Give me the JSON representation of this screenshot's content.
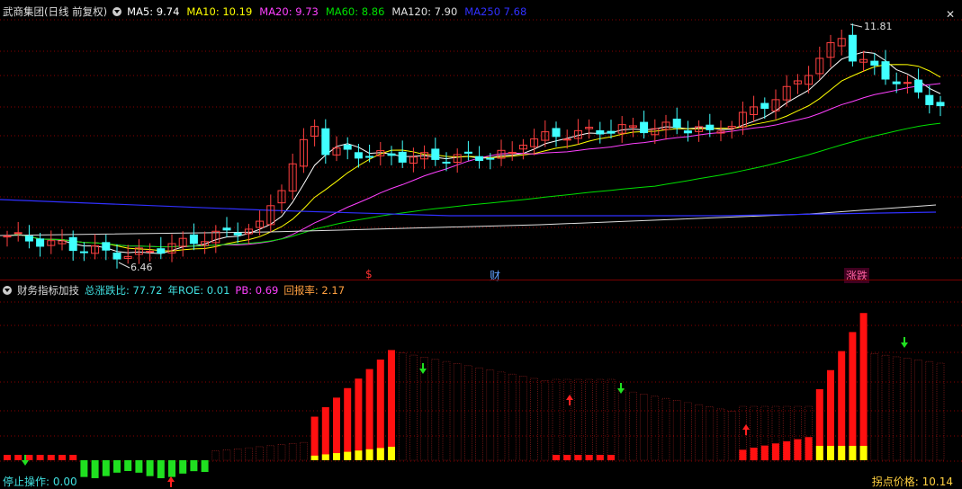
{
  "main_header": {
    "title": "武商集团(日线 前复权)",
    "indicators": [
      {
        "label": "MA5:",
        "value": "9.74",
        "color": "#ffffff"
      },
      {
        "label": "MA10:",
        "value": "10.19",
        "color": "#ffff00"
      },
      {
        "label": "MA20:",
        "value": "9.73",
        "color": "#ff40ff"
      },
      {
        "label": "MA60:",
        "value": "8.86",
        "color": "#00e000"
      },
      {
        "label": "MA120:",
        "value": "7.90",
        "color": "#e0e0e0"
      },
      {
        "label": "MA250",
        "value": "7.68",
        "color": "#3030ff"
      }
    ],
    "close_icon": "close-icon"
  },
  "main_chart": {
    "high_label": "11.81",
    "low_label": "6.46",
    "event_markers": [
      {
        "label": "$",
        "color": "#ff3030"
      },
      {
        "label": "财",
        "color": "#60a0ff"
      },
      {
        "label": "涨跌",
        "color": "#ff60a0",
        "bg": "#400020"
      }
    ]
  },
  "sub_header": {
    "title": "财务指标加技",
    "items": [
      {
        "label": "总涨跌比:",
        "value": "77.72",
        "color": "#40e0e0"
      },
      {
        "label": "年ROE:",
        "value": "0.01",
        "color": "#40e0e0"
      },
      {
        "label": "PB:",
        "value": "0.69",
        "color": "#ff40ff"
      },
      {
        "label": "回报率:",
        "value": "2.17",
        "color": "#ffa040"
      }
    ]
  },
  "sub_footer": {
    "left_label": "停止操作:",
    "left_value": "0.00",
    "right_label": "拐点价格:",
    "right_value": "10.14"
  },
  "colors": {
    "up": "#ff4040",
    "down": "#40ffff",
    "grid": "#8a0000"
  }
}
